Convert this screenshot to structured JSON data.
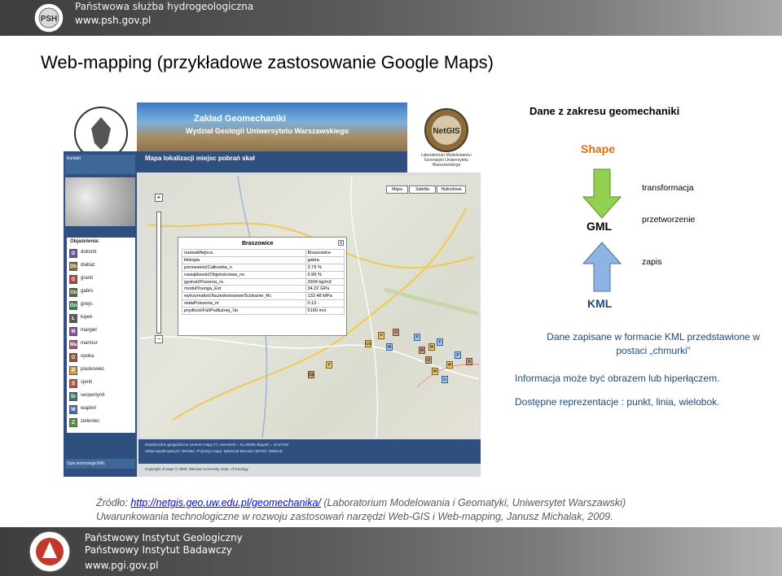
{
  "header": {
    "institution": "Państwowa służba hydrogeologiczna",
    "url": "www.psh.gov.pl",
    "logo_icon": "psh-logo-icon"
  },
  "slide": {
    "title": "Web-mapping (przykładowe zastosowanie Google Maps)"
  },
  "screenshot": {
    "banner_line1": "Zakład Geomechaniki",
    "banner_line2": "Wydział Geologii Uniwersytetu Warszawskiego",
    "nav_title": "Mapa lokalizacji miejsc pobrań skał",
    "map_types": [
      "Mapa",
      "Satelita",
      "Hybrydowa"
    ],
    "zoom_in": "+",
    "zoom_out": "−",
    "legend_title": "Objaśnienia:",
    "legend": [
      {
        "code": "D",
        "label": "dolomit",
        "color": "#6a55a8"
      },
      {
        "code": "Db",
        "label": "diabaz",
        "color": "#8b6a2f"
      },
      {
        "code": "G",
        "label": "granit",
        "color": "#c43b3b"
      },
      {
        "code": "Gb",
        "label": "gabro",
        "color": "#4f6b2f"
      },
      {
        "code": "Gn",
        "label": "gnejs",
        "color": "#3d7f4a"
      },
      {
        "code": "Ł",
        "label": "łupek",
        "color": "#5a5a5a"
      },
      {
        "code": "M",
        "label": "margiel",
        "color": "#8c4fa0"
      },
      {
        "code": "Ma",
        "label": "marmur",
        "color": "#b04f7a"
      },
      {
        "code": "O",
        "label": "opoka",
        "color": "#a0522d"
      },
      {
        "code": "P",
        "label": "piaskowiec",
        "color": "#d4a23a"
      },
      {
        "code": "S",
        "label": "sjenit",
        "color": "#c4553b"
      },
      {
        "code": "Sr",
        "label": "serpentynit",
        "color": "#2f7f6a"
      },
      {
        "code": "W",
        "label": "wapień",
        "color": "#3d6fbf"
      },
      {
        "code": "Z",
        "label": "zieleniec",
        "color": "#4f9a3d"
      }
    ],
    "infowindow": {
      "title": "Braszowice",
      "close_label": "x",
      "rows": [
        {
          "key": "nazwaMiejsca",
          "value": "Braszowice"
        },
        {
          "key": "litologia",
          "value": "gabra"
        },
        {
          "key": "porowatośćCałkowita_n",
          "value": "3.79 %"
        },
        {
          "key": "nasiąkliwośćObjętościowa_no",
          "value": "0.99 %"
        },
        {
          "key": "gęstośćPozorna_ro",
          "value": "2934 kg/m3"
        },
        {
          "key": "modułYounga_Est",
          "value": "34.22 GPa"
        },
        {
          "key": "wytrzymałośćNaJednoosioweŚciskanie_Rc",
          "value": "132.48 MPa"
        },
        {
          "key": "stałaPoissona_ni",
          "value": "0.13 -"
        },
        {
          "key": "prędkośćFaliPodłużnej_Vp",
          "value": "5160 m/s"
        }
      ]
    },
    "markers": [
      "P",
      "W",
      "O",
      "Gb",
      "P",
      "W",
      "W",
      "P",
      "O",
      "W",
      "P",
      "S",
      "W",
      "G",
      "Gb",
      "P"
    ],
    "coord_line1": "Współrzędne geograficzne centrum mapy (*): szerokość = 51.05085 długość = 16.67154",
    "coord_line2": "Układ współrzędnych: WGS84. Projekcja mapy: Spherical Mercator (EPSG: 900913)",
    "footer_copyright": "Copyright of page © 2009, Warsaw University, Dept. of Geology",
    "side_contact": "Kontakt",
    "side_bottom": "Opis technologii KML",
    "netgis_label": "NetGIS",
    "netgis_caption": "Laboratorium Modelowania i Geomatyki Uniwersytetu Warszawskiego"
  },
  "flow": {
    "heading": "Dane z zakresu geomechaniki",
    "shape_label": "Shape",
    "step1": "transformacja",
    "gml_label": "GML",
    "step2": "przetworzenie",
    "step3": "zapis",
    "kml_label": "KML",
    "colors": {
      "shape": "#e46c0a",
      "arrow_top": "#92d050",
      "arrow_bottom": "#8eb4e3",
      "kml": "#1f497d"
    }
  },
  "description": {
    "line1": "Dane zapisane w formacie KML przedstawione w postaci „chmurki”",
    "line2": "Informacja może być obrazem lub hiperłączem.",
    "line3": "Dostępne reprezentacje : punkt, linia, wielobok."
  },
  "source": {
    "prefix": "Źródło:",
    "link1": "http://netgis.geo.uw.edu.pl/geomechanika/",
    "rest1": "(Laboratorium Modelowania i Geomatyki, Uniwersytet Warszawski)",
    "line2": "Uwarunkowania technologiczne w rozwoju zastosowań narzędzi Web-GIS i Web-mapping, Janusz Michalak, 2009."
  },
  "footer": {
    "line1": "Państwowy Instytut Geologiczny",
    "line2": "Państwowy Instytut Badawczy",
    "url": "www.pgi.gov.pl",
    "logo_icon": "pig-logo-icon"
  }
}
